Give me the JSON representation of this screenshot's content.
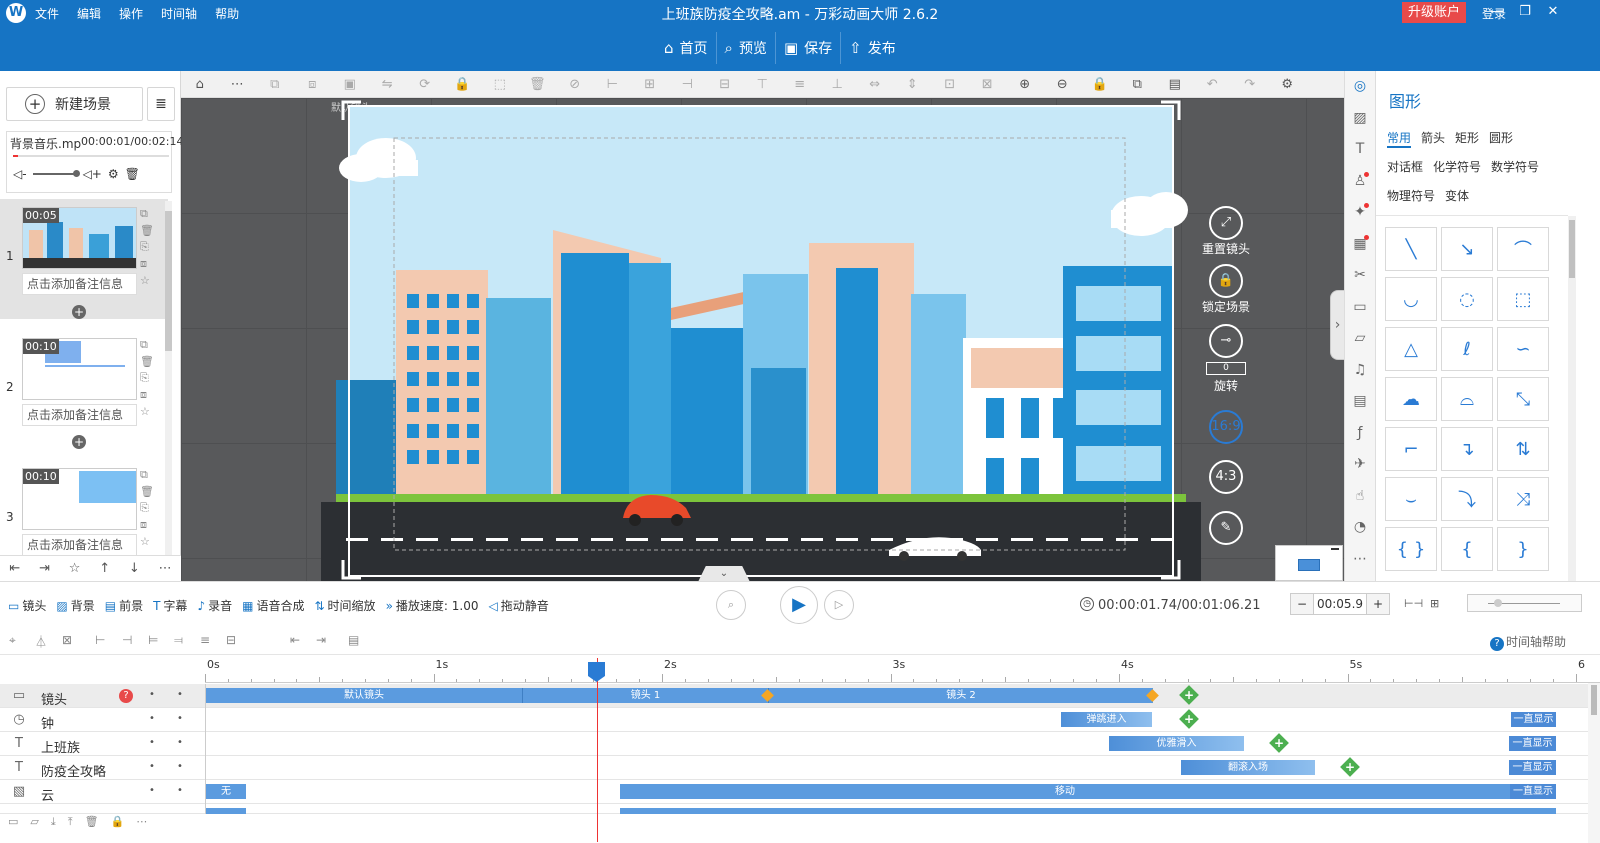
{
  "menu": [
    "文件",
    "编辑",
    "操作",
    "时间轴",
    "帮助"
  ],
  "app_title": "上班族防疫全攻略.am - 万彩动画大师 2.6.2",
  "upgrade": "升级账户",
  "login": "登录",
  "main_toolbar": [
    {
      "icon": "home-icon",
      "glyph": "⌂",
      "label": "首页"
    },
    {
      "icon": "preview-icon",
      "glyph": "⌕",
      "label": "预览"
    },
    {
      "icon": "save-icon",
      "glyph": "▣",
      "label": "保存"
    },
    {
      "icon": "publish-icon",
      "glyph": "⇧",
      "label": "发布"
    }
  ],
  "left": {
    "new_scene": "新建场景",
    "music_name": "背景音乐.mp",
    "music_time": "00:00:01/00:02:14",
    "music_progress": 0.03,
    "scenes": [
      {
        "num": "1",
        "duration": "00:05",
        "note": "点击添加备注信息"
      },
      {
        "num": "2",
        "duration": "00:10",
        "note": "点击添加备注信息"
      },
      {
        "num": "3",
        "duration": "00:10",
        "note": "点击添加备注信息"
      }
    ]
  },
  "canvas": {
    "camera_label": "默认镜头",
    "reset_camera": "重置镜头",
    "lock_scene": "锁定场景",
    "rotate": "旋转",
    "rotate_value": "0",
    "ratio_169": "16:9",
    "ratio_43": "4:3"
  },
  "shapes_panel": {
    "title": "图形",
    "categories": [
      "常用",
      "箭头",
      "矩形",
      "圆形",
      "对话框",
      "化学符号",
      "数学符号",
      "物理符号",
      "变体"
    ],
    "active_category": "常用"
  },
  "controls": {
    "items": [
      {
        "icon": "camera-icon",
        "glyph": "▭",
        "label": "镜头"
      },
      {
        "icon": "background-icon",
        "glyph": "▨",
        "label": "背景"
      },
      {
        "icon": "foreground-icon",
        "glyph": "▤",
        "label": "前景"
      },
      {
        "icon": "subtitle-icon",
        "glyph": "T",
        "label": "字幕"
      },
      {
        "icon": "mic-icon",
        "glyph": "♪",
        "label": "录音"
      },
      {
        "icon": "tts-icon",
        "glyph": "▦",
        "label": "语音合成"
      },
      {
        "icon": "time-scale-icon",
        "glyph": "⇅",
        "label": "时间缩放"
      },
      {
        "icon": "speed-icon",
        "glyph": "»",
        "label": "播放速度: 1.00"
      },
      {
        "icon": "mute-icon",
        "glyph": "◁",
        "label": "拖动静音"
      }
    ],
    "time_display": "00:00:01.74/00:01:06.21",
    "duration": "00:05.9"
  },
  "timeline": {
    "help": "时间轴帮助",
    "ruler": [
      "0s",
      "1s",
      "2s",
      "3s",
      "4s",
      "5s",
      "6"
    ],
    "tracks": [
      {
        "icon": "camera-icon",
        "glyph": "▭",
        "name": "镜头"
      },
      {
        "icon": "clock-icon",
        "glyph": "◷",
        "name": "钟"
      },
      {
        "icon": "text-icon",
        "glyph": "T",
        "name": "上班族"
      },
      {
        "icon": "text-icon",
        "glyph": "T",
        "name": "防疫全攻略"
      },
      {
        "icon": "image-icon",
        "glyph": "▧",
        "name": "云"
      }
    ],
    "segments": {
      "default_camera": "默认镜头",
      "camera1": "镜头 1",
      "camera2": "镜头 2",
      "clock_enter": "弹跳进入",
      "worker_enter": "优雅滑入",
      "title_enter": "翻滚入场",
      "cloud_none": "无",
      "cloud_move": "移动",
      "always_show": "一直显示"
    }
  }
}
